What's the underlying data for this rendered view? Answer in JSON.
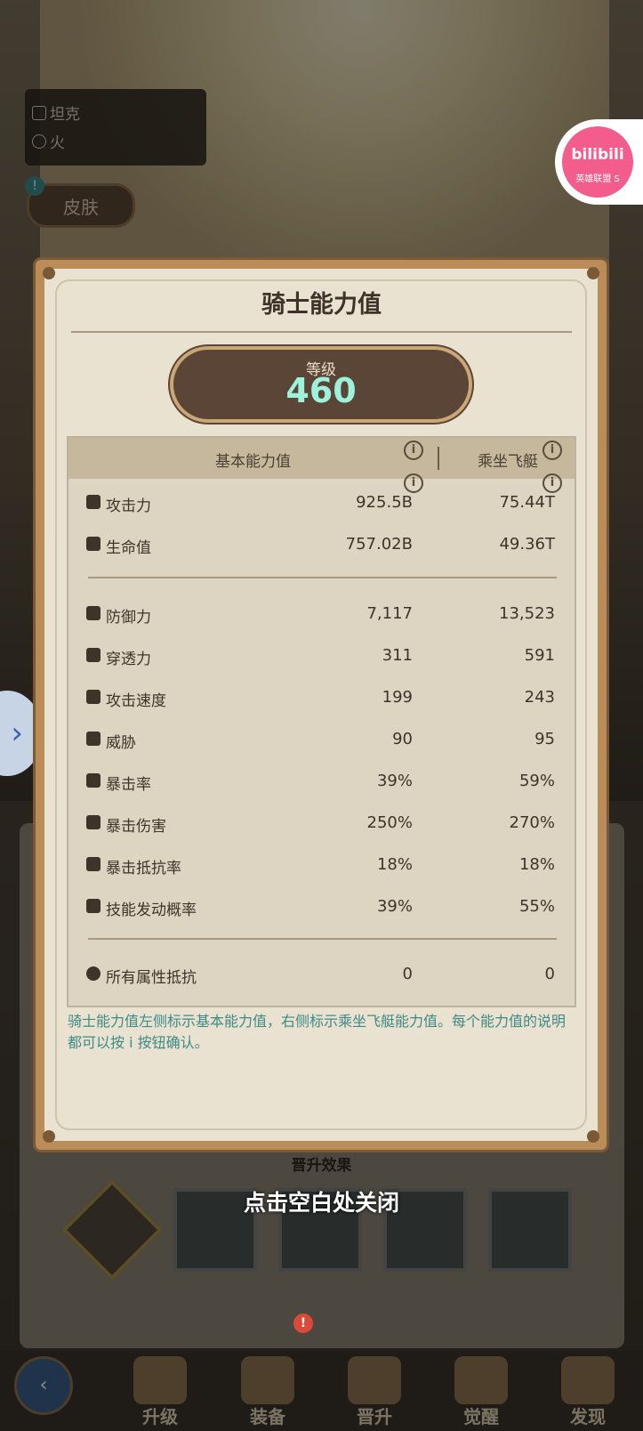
{
  "hero": {
    "role_label": "坦克",
    "element_label": "火",
    "skin_button": "皮肤"
  },
  "overlay_brand": {
    "logo_text": "bilibili",
    "sub_text": "英雄联盟 S"
  },
  "modal": {
    "title": "骑士能力值",
    "level_label": "等级",
    "level_value": "460",
    "header_base": "基本能力值",
    "header_mount": "乘坐飞艇",
    "rows": [
      {
        "icon": "sword-icon",
        "label": "攻击力",
        "base": "925.5B",
        "mount": "75.44T"
      },
      {
        "icon": "heart-icon",
        "label": "生命值",
        "base": "757.02B",
        "mount": "49.36T"
      },
      {
        "icon": "shield-half-icon",
        "label": "防御力",
        "base": "7,117",
        "mount": "13,523"
      },
      {
        "icon": "penetration-icon",
        "label": "穿透力",
        "base": "311",
        "mount": "591"
      },
      {
        "icon": "attack-speed-icon",
        "label": "攻击速度",
        "base": "199",
        "mount": "243"
      },
      {
        "icon": "threat-icon",
        "label": "威胁",
        "base": "90",
        "mount": "95"
      },
      {
        "icon": "crit-rate-icon",
        "label": "暴击率",
        "base": "39%",
        "mount": "59%"
      },
      {
        "icon": "crit-damage-icon",
        "label": "暴击伤害",
        "base": "250%",
        "mount": "270%"
      },
      {
        "icon": "crit-resist-icon",
        "label": "暴击抵抗率",
        "base": "18%",
        "mount": "18%"
      },
      {
        "icon": "skill-trigger-icon",
        "label": "技能发动概率",
        "base": "39%",
        "mount": "55%"
      },
      {
        "icon": "all-resist-icon",
        "label": "所有属性抵抗",
        "base": "0",
        "mount": "0"
      }
    ],
    "description": "骑士能力值左侧标示基本能力值，右侧标示乘坐飞艇能力值。每个能力值的说明都可以按 i 按钮确认。"
  },
  "background": {
    "promotion_label": "晋升效果",
    "close_hint": "点击空白处关闭"
  },
  "nav": {
    "items": [
      {
        "label": "升级"
      },
      {
        "label": "装备"
      },
      {
        "label": "晋升"
      },
      {
        "label": "觉醒"
      },
      {
        "label": "发现"
      }
    ],
    "badge": "!"
  }
}
